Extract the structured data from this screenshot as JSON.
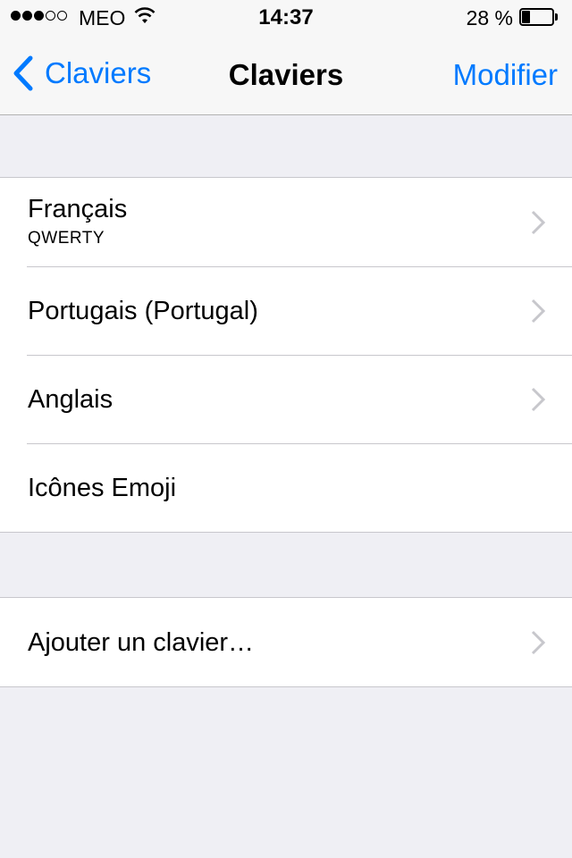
{
  "status_bar": {
    "signal_dots_filled": 3,
    "signal_dots_total": 5,
    "carrier": "MEO",
    "time": "14:37",
    "battery_percent_text": "28 %",
    "battery_level": 0.28
  },
  "nav": {
    "back_label": "Claviers",
    "title": "Claviers",
    "edit_label": "Modifier"
  },
  "keyboards": [
    {
      "label": "Français",
      "sublabel": "QWERTY",
      "chevron": true
    },
    {
      "label": "Portugais (Portugal)",
      "chevron": true
    },
    {
      "label": "Anglais",
      "chevron": true
    },
    {
      "label": "Icônes Emoji",
      "chevron": false
    }
  ],
  "add_keyboard": {
    "label": "Ajouter un clavier…",
    "chevron": true
  },
  "colors": {
    "accent": "#007aff",
    "background": "#efeff4",
    "separator": "#c8c7cc",
    "chevron": "#c7c7cc"
  },
  "icons": [
    "wifi-icon",
    "battery-icon",
    "back-chevron-icon",
    "chevron-right-icon"
  ]
}
